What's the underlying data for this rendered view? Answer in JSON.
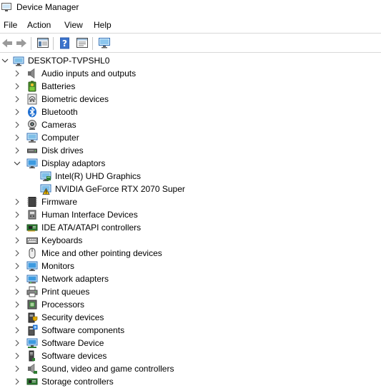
{
  "window": {
    "title": "Device Manager"
  },
  "menu": [
    "File",
    "Action",
    "View",
    "Help"
  ],
  "tree": {
    "root": "DESKTOP-TVPSHL0",
    "categories": [
      {
        "label": "Audio inputs and outputs",
        "icon": "speaker-icon"
      },
      {
        "label": "Batteries",
        "icon": "battery-icon"
      },
      {
        "label": "Biometric devices",
        "icon": "fingerprint-icon"
      },
      {
        "label": "Bluetooth",
        "icon": "bluetooth-icon"
      },
      {
        "label": "Cameras",
        "icon": "camera-icon"
      },
      {
        "label": "Computer",
        "icon": "computer-icon"
      },
      {
        "label": "Disk drives",
        "icon": "disk-drive-icon"
      },
      {
        "label": "Display adaptors",
        "icon": "monitor-icon",
        "expanded": true,
        "children": [
          {
            "label": "Intel(R) UHD Graphics",
            "icon": "display-adapter-icon"
          },
          {
            "label": "NVIDIA GeForce RTX 2070 Super",
            "icon": "warning-display-adapter-icon",
            "status": "warning"
          }
        ]
      },
      {
        "label": "Firmware",
        "icon": "firmware-icon"
      },
      {
        "label": "Human Interface Devices",
        "icon": "hid-icon"
      },
      {
        "label": "IDE ATA/ATAPI controllers",
        "icon": "ide-controller-icon"
      },
      {
        "label": "Keyboards",
        "icon": "keyboard-icon"
      },
      {
        "label": "Mice and other pointing devices",
        "icon": "mouse-icon"
      },
      {
        "label": "Monitors",
        "icon": "monitor-icon"
      },
      {
        "label": "Network adapters",
        "icon": "network-adapter-icon"
      },
      {
        "label": "Print queues",
        "icon": "printer-icon"
      },
      {
        "label": "Processors",
        "icon": "processor-icon"
      },
      {
        "label": "Security devices",
        "icon": "security-device-icon"
      },
      {
        "label": "Software components",
        "icon": "software-component-icon"
      },
      {
        "label": "Software Device",
        "icon": "software-device-icon"
      },
      {
        "label": "Software devices",
        "icon": "software-devices-icon"
      },
      {
        "label": "Sound, video and game controllers",
        "icon": "sound-controller-icon"
      },
      {
        "label": "Storage controllers",
        "icon": "storage-controller-icon"
      }
    ]
  }
}
